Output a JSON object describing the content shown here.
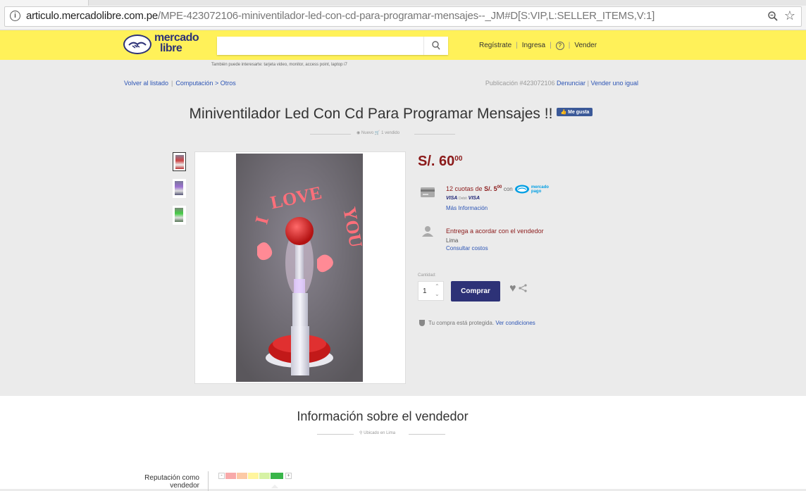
{
  "browser": {
    "url_host": "articulo.mercadolibre.com.pe",
    "url_path": "/MPE-423072106-miniventilador-led-con-cd-para-programar-mensajes--_JM#D[S:VIP,L:SELLER_ITEMS,V:1]",
    "info_symbol": "i",
    "star_symbol": "☆"
  },
  "header": {
    "logo_line1": "mercado",
    "logo_line2": "libre",
    "search_placeholder": "",
    "links": [
      "Regístrate",
      "Ingresa",
      "?",
      "Vender"
    ]
  },
  "suggestions": "También puede interesarte: tarjeta video, monitor, access point, laptop i7",
  "breadcrumb": {
    "back": "Volver al listado",
    "cat1": "Computación",
    "sep": ">",
    "cat2": "Otros"
  },
  "publication": {
    "label": "Publicación #423072106",
    "report": "Denunciar",
    "sell_same": "Vender uno igual"
  },
  "product": {
    "title": "Miniventilador Led Con Cd Para Programar Mensajes !!",
    "like_label": "Me gusta",
    "condition": "Nuevo",
    "sold": "1 vendido"
  },
  "photo_text": {
    "i": "I",
    "love": "LOVE",
    "you": "YOU"
  },
  "buybox": {
    "currency": "S/.",
    "price_int": "60",
    "price_dec": "00",
    "cuotas_text": "12 cuotas de",
    "cuota_currency": "S/.",
    "cuota_int": "5",
    "cuota_dec": "00",
    "con": "con",
    "mp_line1": "mercado",
    "mp_line2": "pago",
    "card1": "VISA",
    "card_mid": "Debit",
    "card2": "VISA",
    "more_info": "Más Información",
    "delivery": "Entrega a acordar con el vendedor",
    "location": "Lima",
    "consult": "Consultar costos",
    "qty_label": "Cantidad:",
    "qty_value": "1",
    "buy_label": "Comprar",
    "protected_text": "Tu compra está protegida.",
    "conditions": "Ver condiciones"
  },
  "seller": {
    "title": "Información sobre el vendedor",
    "location": "Ubicado en Lima",
    "reputation_line1": "Reputación como",
    "reputation_line2": "vendedor",
    "minus": "-",
    "plus": "+"
  },
  "colors": {
    "ml_yellow": "#fff159",
    "brand_blue": "#2d3277",
    "price_red": "#8b1a1a",
    "link_blue": "#2d55b5"
  }
}
